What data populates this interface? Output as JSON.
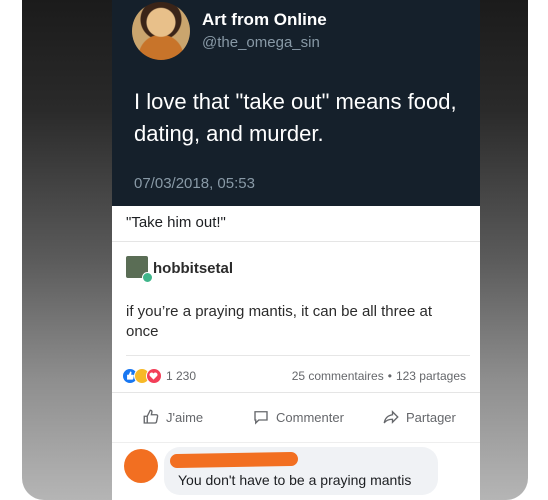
{
  "tweet": {
    "display_name": "Art from Online",
    "handle": "@the_omega_sin",
    "text": "I love that \"take out\" means food, dating, and murder.",
    "timestamp": "07/03/2018, 05:53"
  },
  "quote": {
    "text": "\"Take him out!\""
  },
  "tumblr_post": {
    "username": "hobbitsetal",
    "text": "if you’re a praying mantis, it can be all three at once"
  },
  "facebook": {
    "reactions": [
      "like-icon",
      "haha-icon",
      "love-icon"
    ],
    "reaction_count": "1 230",
    "comments": "25 commentaires",
    "separator": "•",
    "shares": "123 partages",
    "actions": {
      "like": "J'aime",
      "comment": "Commenter",
      "share": "Partager"
    },
    "comment": {
      "text": "You don't have to be a praying mantis"
    }
  },
  "colors": {
    "tweet_bg": "#15202b",
    "redaction": "#f26f21",
    "fb_blue": "#1877f2"
  }
}
